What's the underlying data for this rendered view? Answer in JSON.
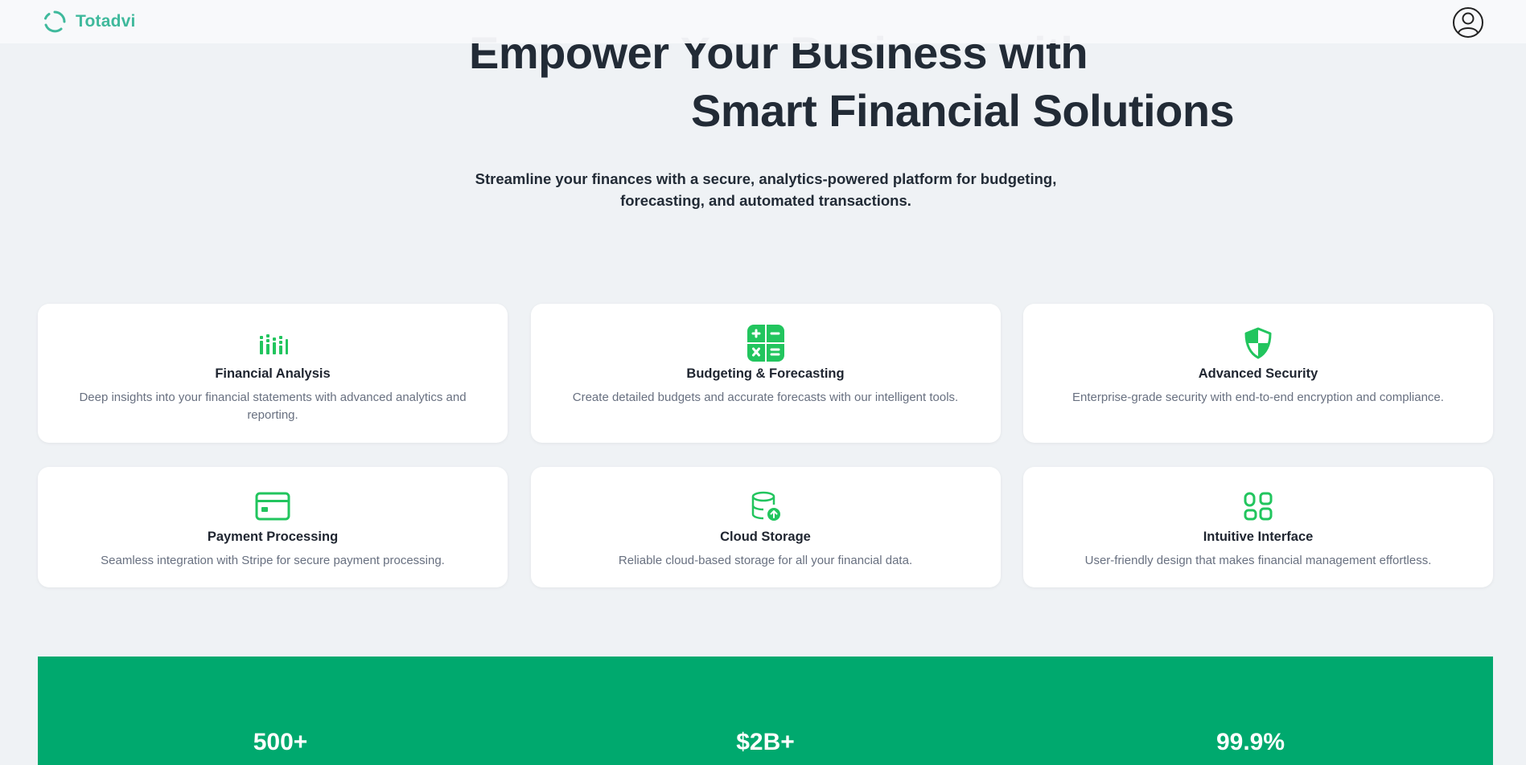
{
  "navbar": {
    "brand_name": "Totadvi",
    "logo_icon": "ring-logo-icon",
    "profile_icon": "user-circle-icon"
  },
  "hero": {
    "title_line1": "Empower Your Business with",
    "title_line2": "Smart Financial Solutions",
    "subtitle": "Streamline your finances with a secure, analytics-powered platform for budgeting, forecasting, and automated transactions."
  },
  "features": [
    {
      "icon": "bar-chart-icon",
      "title": "Financial Analysis",
      "description": "Deep insights into your financial statements with advanced analytics and reporting."
    },
    {
      "icon": "calculator-icon",
      "title": "Budgeting & Forecasting",
      "description": "Create detailed budgets and accurate forecasts with our intelligent tools."
    },
    {
      "icon": "shield-icon",
      "title": "Advanced Security",
      "description": "Enterprise-grade security with end-to-end encryption and compliance."
    },
    {
      "icon": "credit-card-icon",
      "title": "Payment Processing",
      "description": "Seamless integration with Stripe for secure payment processing."
    },
    {
      "icon": "database-upload-icon",
      "title": "Cloud Storage",
      "description": "Reliable cloud-based storage for all your financial data."
    },
    {
      "icon": "grid-apps-icon",
      "title": "Intuitive Interface",
      "description": "User-friendly design that makes financial management effortless."
    }
  ],
  "stats": [
    {
      "value": "500+"
    },
    {
      "value": "$2B+"
    },
    {
      "value": "99.9%"
    }
  ],
  "colors": {
    "accent": "#22c55e",
    "brand": "#3fb99c",
    "stats_band": "#00a96e",
    "background": "#eff2f5"
  }
}
